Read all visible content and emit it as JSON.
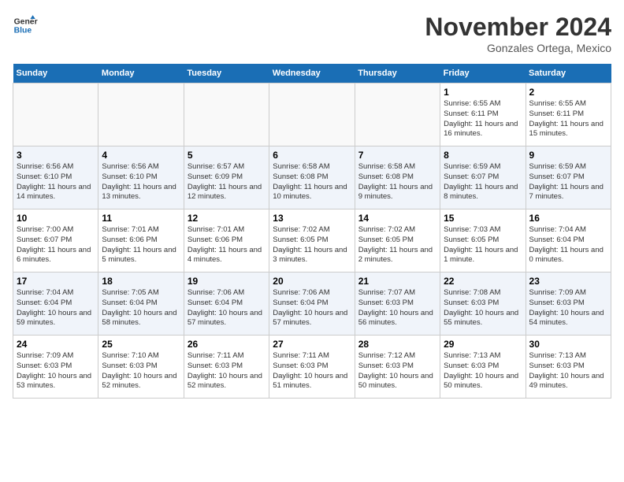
{
  "header": {
    "logo_line1": "General",
    "logo_line2": "Blue",
    "month": "November 2024",
    "location": "Gonzales Ortega, Mexico"
  },
  "weekdays": [
    "Sunday",
    "Monday",
    "Tuesday",
    "Wednesday",
    "Thursday",
    "Friday",
    "Saturday"
  ],
  "weeks": [
    [
      {
        "day": "",
        "empty": true
      },
      {
        "day": "",
        "empty": true
      },
      {
        "day": "",
        "empty": true
      },
      {
        "day": "",
        "empty": true
      },
      {
        "day": "",
        "empty": true
      },
      {
        "day": "1",
        "sunrise": "Sunrise: 6:55 AM",
        "sunset": "Sunset: 6:11 PM",
        "daylight": "Daylight: 11 hours and 16 minutes."
      },
      {
        "day": "2",
        "sunrise": "Sunrise: 6:55 AM",
        "sunset": "Sunset: 6:11 PM",
        "daylight": "Daylight: 11 hours and 15 minutes."
      }
    ],
    [
      {
        "day": "3",
        "sunrise": "Sunrise: 6:56 AM",
        "sunset": "Sunset: 6:10 PM",
        "daylight": "Daylight: 11 hours and 14 minutes."
      },
      {
        "day": "4",
        "sunrise": "Sunrise: 6:56 AM",
        "sunset": "Sunset: 6:10 PM",
        "daylight": "Daylight: 11 hours and 13 minutes."
      },
      {
        "day": "5",
        "sunrise": "Sunrise: 6:57 AM",
        "sunset": "Sunset: 6:09 PM",
        "daylight": "Daylight: 11 hours and 12 minutes."
      },
      {
        "day": "6",
        "sunrise": "Sunrise: 6:58 AM",
        "sunset": "Sunset: 6:08 PM",
        "daylight": "Daylight: 11 hours and 10 minutes."
      },
      {
        "day": "7",
        "sunrise": "Sunrise: 6:58 AM",
        "sunset": "Sunset: 6:08 PM",
        "daylight": "Daylight: 11 hours and 9 minutes."
      },
      {
        "day": "8",
        "sunrise": "Sunrise: 6:59 AM",
        "sunset": "Sunset: 6:07 PM",
        "daylight": "Daylight: 11 hours and 8 minutes."
      },
      {
        "day": "9",
        "sunrise": "Sunrise: 6:59 AM",
        "sunset": "Sunset: 6:07 PM",
        "daylight": "Daylight: 11 hours and 7 minutes."
      }
    ],
    [
      {
        "day": "10",
        "sunrise": "Sunrise: 7:00 AM",
        "sunset": "Sunset: 6:07 PM",
        "daylight": "Daylight: 11 hours and 6 minutes."
      },
      {
        "day": "11",
        "sunrise": "Sunrise: 7:01 AM",
        "sunset": "Sunset: 6:06 PM",
        "daylight": "Daylight: 11 hours and 5 minutes."
      },
      {
        "day": "12",
        "sunrise": "Sunrise: 7:01 AM",
        "sunset": "Sunset: 6:06 PM",
        "daylight": "Daylight: 11 hours and 4 minutes."
      },
      {
        "day": "13",
        "sunrise": "Sunrise: 7:02 AM",
        "sunset": "Sunset: 6:05 PM",
        "daylight": "Daylight: 11 hours and 3 minutes."
      },
      {
        "day": "14",
        "sunrise": "Sunrise: 7:02 AM",
        "sunset": "Sunset: 6:05 PM",
        "daylight": "Daylight: 11 hours and 2 minutes."
      },
      {
        "day": "15",
        "sunrise": "Sunrise: 7:03 AM",
        "sunset": "Sunset: 6:05 PM",
        "daylight": "Daylight: 11 hours and 1 minute."
      },
      {
        "day": "16",
        "sunrise": "Sunrise: 7:04 AM",
        "sunset": "Sunset: 6:04 PM",
        "daylight": "Daylight: 11 hours and 0 minutes."
      }
    ],
    [
      {
        "day": "17",
        "sunrise": "Sunrise: 7:04 AM",
        "sunset": "Sunset: 6:04 PM",
        "daylight": "Daylight: 10 hours and 59 minutes."
      },
      {
        "day": "18",
        "sunrise": "Sunrise: 7:05 AM",
        "sunset": "Sunset: 6:04 PM",
        "daylight": "Daylight: 10 hours and 58 minutes."
      },
      {
        "day": "19",
        "sunrise": "Sunrise: 7:06 AM",
        "sunset": "Sunset: 6:04 PM",
        "daylight": "Daylight: 10 hours and 57 minutes."
      },
      {
        "day": "20",
        "sunrise": "Sunrise: 7:06 AM",
        "sunset": "Sunset: 6:04 PM",
        "daylight": "Daylight: 10 hours and 57 minutes."
      },
      {
        "day": "21",
        "sunrise": "Sunrise: 7:07 AM",
        "sunset": "Sunset: 6:03 PM",
        "daylight": "Daylight: 10 hours and 56 minutes."
      },
      {
        "day": "22",
        "sunrise": "Sunrise: 7:08 AM",
        "sunset": "Sunset: 6:03 PM",
        "daylight": "Daylight: 10 hours and 55 minutes."
      },
      {
        "day": "23",
        "sunrise": "Sunrise: 7:09 AM",
        "sunset": "Sunset: 6:03 PM",
        "daylight": "Daylight: 10 hours and 54 minutes."
      }
    ],
    [
      {
        "day": "24",
        "sunrise": "Sunrise: 7:09 AM",
        "sunset": "Sunset: 6:03 PM",
        "daylight": "Daylight: 10 hours and 53 minutes."
      },
      {
        "day": "25",
        "sunrise": "Sunrise: 7:10 AM",
        "sunset": "Sunset: 6:03 PM",
        "daylight": "Daylight: 10 hours and 52 minutes."
      },
      {
        "day": "26",
        "sunrise": "Sunrise: 7:11 AM",
        "sunset": "Sunset: 6:03 PM",
        "daylight": "Daylight: 10 hours and 52 minutes."
      },
      {
        "day": "27",
        "sunrise": "Sunrise: 7:11 AM",
        "sunset": "Sunset: 6:03 PM",
        "daylight": "Daylight: 10 hours and 51 minutes."
      },
      {
        "day": "28",
        "sunrise": "Sunrise: 7:12 AM",
        "sunset": "Sunset: 6:03 PM",
        "daylight": "Daylight: 10 hours and 50 minutes."
      },
      {
        "day": "29",
        "sunrise": "Sunrise: 7:13 AM",
        "sunset": "Sunset: 6:03 PM",
        "daylight": "Daylight: 10 hours and 50 minutes."
      },
      {
        "day": "30",
        "sunrise": "Sunrise: 7:13 AM",
        "sunset": "Sunset: 6:03 PM",
        "daylight": "Daylight: 10 hours and 49 minutes."
      }
    ]
  ]
}
